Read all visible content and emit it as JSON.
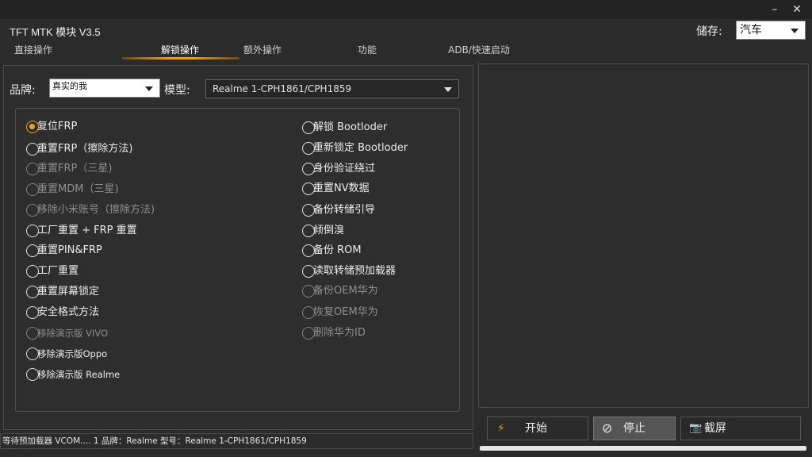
{
  "window": {
    "minimize_icon": "minimize-icon",
    "close_icon": "close-icon",
    "minimize_glyph": "–",
    "close_glyph": "✕"
  },
  "app": {
    "title": "TFT MTK 模块 V3.5"
  },
  "storage": {
    "label": "储存:",
    "value": "汽车"
  },
  "tabs": [
    {
      "label": "直接操作",
      "active": false
    },
    {
      "label": "解锁操作",
      "active": true
    },
    {
      "label": "额外操作",
      "active": false
    },
    {
      "label": "功能",
      "active": false
    },
    {
      "label": "ADB/快速启动",
      "active": false
    }
  ],
  "brand": {
    "label": "品牌:",
    "value": "真实的我"
  },
  "model": {
    "label": "模型:",
    "value": "Realme 1-CPH1861/CPH1859"
  },
  "options_left": [
    {
      "label": "复位FRP",
      "checked": true,
      "disabled": false
    },
    {
      "label": "重置FRP（擦除方法)",
      "checked": false,
      "disabled": false
    },
    {
      "label": "重置FRP（三星)",
      "checked": false,
      "disabled": true
    },
    {
      "label": "重置MDM（三星)",
      "checked": false,
      "disabled": true
    },
    {
      "label": "移除小米账号（擦除方法)",
      "checked": false,
      "disabled": true
    },
    {
      "label": "工厂重置 + FRP 重置",
      "checked": false,
      "disabled": false
    },
    {
      "label": "重置PIN&FRP",
      "checked": false,
      "disabled": false
    },
    {
      "label": "工厂重置",
      "checked": false,
      "disabled": false
    },
    {
      "label": "重置屏幕锁定",
      "checked": false,
      "disabled": false
    },
    {
      "label": "安全格式方法",
      "checked": false,
      "disabled": false
    },
    {
      "label": "移除演示版 VIVO",
      "checked": false,
      "disabled": true
    },
    {
      "label": "移除演示版Oppo",
      "checked": false,
      "disabled": false
    },
    {
      "label": "移除演示版 Realme",
      "checked": false,
      "disabled": false
    }
  ],
  "options_right": [
    {
      "label": "解锁 Bootloder",
      "checked": false,
      "disabled": false
    },
    {
      "label": "重新锁定 Bootloder",
      "checked": false,
      "disabled": false
    },
    {
      "label": "身份验证绕过",
      "checked": false,
      "disabled": false
    },
    {
      "label": "重置NV数据",
      "checked": false,
      "disabled": false
    },
    {
      "label": "备份转储引导",
      "checked": false,
      "disabled": false
    },
    {
      "label": "倾倒溴",
      "checked": false,
      "disabled": false
    },
    {
      "label": "备份 ROM",
      "checked": false,
      "disabled": false
    },
    {
      "label": "读取转储预加载器",
      "checked": false,
      "disabled": false
    },
    {
      "label": "备份OEM华为",
      "checked": false,
      "disabled": true
    },
    {
      "label": "恢复OEM华为",
      "checked": false,
      "disabled": true
    },
    {
      "label": "删除华为ID",
      "checked": false,
      "disabled": true
    }
  ],
  "buttons": {
    "start": {
      "label": "开始",
      "icon": "lightning-icon",
      "glyph": "⚡"
    },
    "stop": {
      "label": "停止",
      "icon": "stop-icon",
      "glyph": "⊘"
    },
    "screenshot": {
      "label": "截屏",
      "icon": "camera-icon",
      "glyph": "📷"
    }
  },
  "status": {
    "text": "等待预加载器 VCOM.... 1 品牌：Realme 型号：Realme 1-CPH1861/CPH1859"
  },
  "colors": {
    "accent": "#f0a020",
    "background": "#2b2b2b"
  }
}
